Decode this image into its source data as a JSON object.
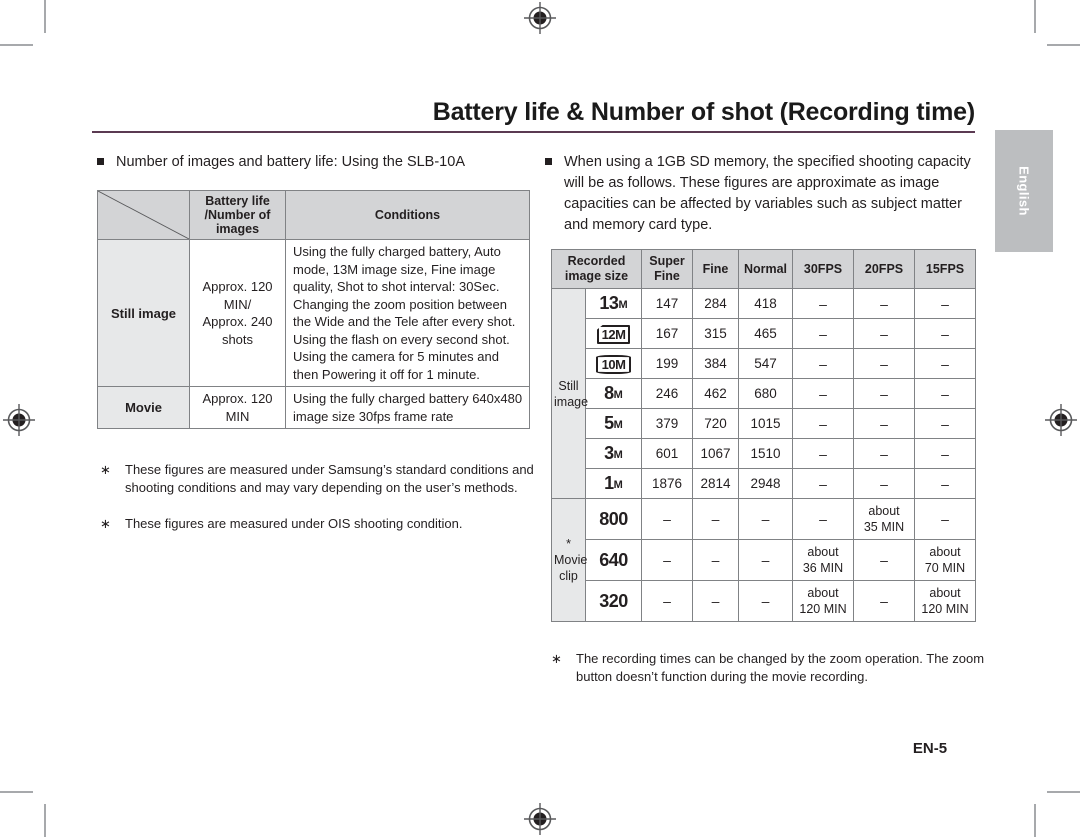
{
  "page": {
    "title": "Battery life & Number of shot (Recording time)",
    "page_number": "EN-5",
    "language_tab": "English",
    "accent_rule_color": "#5b3a52"
  },
  "left_section": {
    "bullet": "Number of images and battery life: Using the SLB-10A",
    "table": {
      "headers": {
        "corner": "",
        "battery": "Battery life\n/Number of\nimages",
        "battery_line1": "Battery life",
        "battery_line2": "/Number of",
        "battery_line3": "images",
        "conditions": "Conditions"
      },
      "rows": [
        {
          "label": "Still image",
          "value_line1": "Approx. 120",
          "value_line2": "MIN/",
          "value_line3": "Approx. 240",
          "value_line4": "shots",
          "conditions": "Using the fully charged battery, Auto mode, 13M image size, Fine image quality, Shot to shot interval: 30Sec. Changing the zoom position between the Wide and the Tele after every shot. Using the flash on every second shot. Using the camera for 5 minutes and then Powering it off for 1 minute."
        },
        {
          "label": "Movie",
          "value_line1": "Approx. 120",
          "value_line2": "MIN",
          "value_line3": "",
          "value_line4": "",
          "conditions": "Using the fully charged battery 640x480 image size 30fps frame rate"
        }
      ]
    },
    "notes": [
      {
        "marker": "∗",
        "text": "These figures are measured under Samsung’s standard conditions and shooting conditions and may vary depending on the user’s methods."
      },
      {
        "marker": "∗",
        "text": "These figures are measured under OIS shooting condition."
      }
    ]
  },
  "right_section": {
    "bullet": "When using a 1GB SD memory, the specified shooting capacity will be as follows. These figures are approximate as image capacities can be affected by variables such as subject matter and memory card type.",
    "table": {
      "headers": {
        "recorded_size_line1": "Recorded",
        "recorded_size_line2": "image size",
        "super_fine_line1": "Super",
        "super_fine_line2": "Fine",
        "fine": "Fine",
        "normal": "Normal",
        "fps30": "30FPS",
        "fps20": "20FPS",
        "fps15": "15FPS"
      },
      "group_still": {
        "line1": "Still",
        "line2": "image"
      },
      "group_movie": {
        "line1": "* Movie",
        "line2": "clip"
      },
      "still_rows": [
        {
          "size_num": "13",
          "size_unit": "M",
          "style": "plain",
          "super_fine": "147",
          "fine": "284",
          "normal": "418",
          "fps30": "–",
          "fps20": "–",
          "fps15": "–"
        },
        {
          "size_num": "12",
          "size_unit": "M",
          "style": "cut",
          "super_fine": "167",
          "fine": "315",
          "normal": "465",
          "fps30": "–",
          "fps20": "–",
          "fps15": "–"
        },
        {
          "size_num": "10",
          "size_unit": "M",
          "style": "wide",
          "super_fine": "199",
          "fine": "384",
          "normal": "547",
          "fps30": "–",
          "fps20": "–",
          "fps15": "–"
        },
        {
          "size_num": "8",
          "size_unit": "M",
          "style": "plain",
          "super_fine": "246",
          "fine": "462",
          "normal": "680",
          "fps30": "–",
          "fps20": "–",
          "fps15": "–"
        },
        {
          "size_num": "5",
          "size_unit": "M",
          "style": "plain",
          "super_fine": "379",
          "fine": "720",
          "normal": "1015",
          "fps30": "–",
          "fps20": "–",
          "fps15": "–"
        },
        {
          "size_num": "3",
          "size_unit": "M",
          "style": "plain",
          "super_fine": "601",
          "fine": "1067",
          "normal": "1510",
          "fps30": "–",
          "fps20": "–",
          "fps15": "–"
        },
        {
          "size_num": "1",
          "size_unit": "M",
          "style": "plain",
          "super_fine": "1876",
          "fine": "2814",
          "normal": "2948",
          "fps30": "–",
          "fps20": "–",
          "fps15": "–"
        }
      ],
      "movie_rows": [
        {
          "size": "800",
          "super_fine": "–",
          "fine": "–",
          "normal": "–",
          "fps30": "–",
          "fps20_l1": "about",
          "fps20_l2": "35 MIN",
          "fps15": "–"
        },
        {
          "size": "640",
          "super_fine": "–",
          "fine": "–",
          "normal": "–",
          "fps30_l1": "about",
          "fps30_l2": "36 MIN",
          "fps20": "–",
          "fps15_l1": "about",
          "fps15_l2": "70 MIN"
        },
        {
          "size": "320",
          "super_fine": "–",
          "fine": "–",
          "normal": "–",
          "fps30_l1": "about",
          "fps30_l2": "120 MIN",
          "fps20": "–",
          "fps15_l1": "about",
          "fps15_l2": "120 MIN"
        }
      ]
    },
    "notes": [
      {
        "marker": "∗",
        "text": "The recording times can be changed by the zoom operation. The zoom button doesn’t function during the movie recording."
      }
    ]
  }
}
